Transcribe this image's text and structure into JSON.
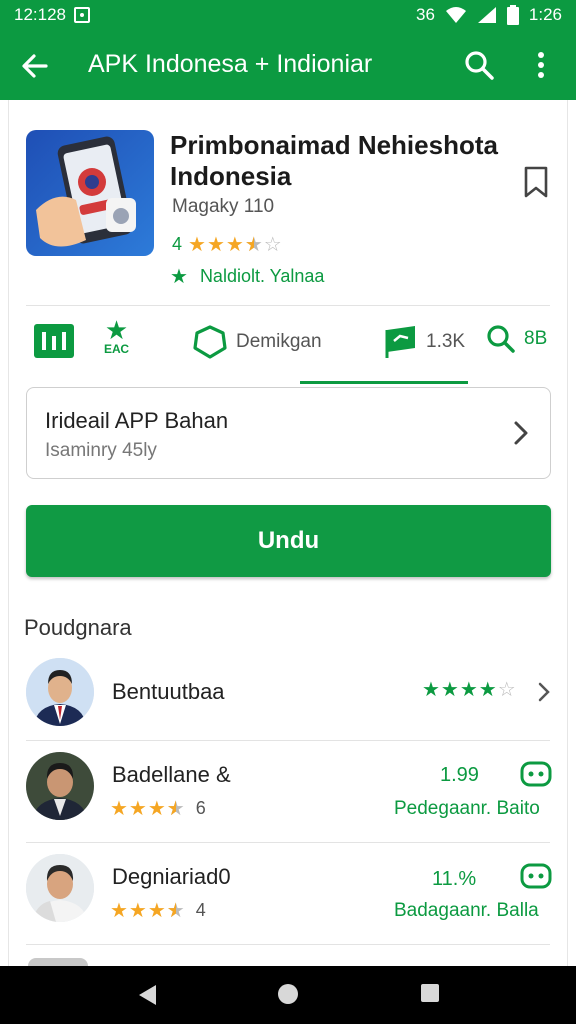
{
  "status": {
    "time_left": "12:128",
    "time_right": "1:26",
    "signal": "36"
  },
  "appbar": {
    "title": "APK Indonesa + Indioniar"
  },
  "app": {
    "name": "Primbonaimad Nehieshota Indonesia",
    "developer": "Magaky 110",
    "rating_prefix": "4",
    "rating_stars": 3.5,
    "editor_label": "Naldiolt. Yalnaa"
  },
  "stats": {
    "s1": "Demikgan",
    "s2": "1.3K",
    "s3": "8B",
    "s0_label": "ЕАС"
  },
  "detail": {
    "title": "Irideail APP Bahan",
    "subtitle": "Isaminry 45ly"
  },
  "install": {
    "label": "Undu"
  },
  "section": {
    "title": "Poudgnara"
  },
  "users": [
    {
      "name": "Bentuutbaa",
      "stars": 4,
      "num": "",
      "label": ""
    },
    {
      "name": "Badellane &",
      "stars": 3.5,
      "count": "6",
      "num": "1.99",
      "label": "Pedegaanr. Baito"
    },
    {
      "name": "Degniariad0",
      "stars": 3.5,
      "count": "4",
      "num": "11.%",
      "label": "Badagaanr. Balla"
    }
  ],
  "colors": {
    "primary": "#0c9a41",
    "star": "#f5a623"
  }
}
